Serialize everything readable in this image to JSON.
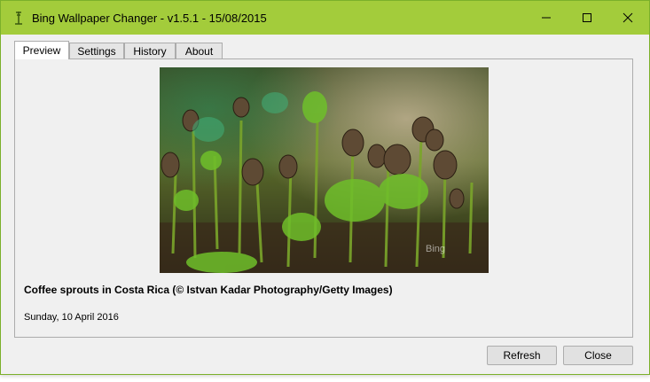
{
  "window": {
    "title": "Bing Wallpaper Changer - v1.5.1 - 15/08/2015",
    "accent_color": "#a3cc3b"
  },
  "tabs": [
    {
      "label": "Preview",
      "active": true
    },
    {
      "label": "Settings",
      "active": false
    },
    {
      "label": "History",
      "active": false
    },
    {
      "label": "About",
      "active": false
    }
  ],
  "preview": {
    "watermark": "Bing",
    "caption": "Coffee sprouts in Costa Rica (© Istvan Kadar Photography/Getty Images)",
    "date": "Sunday, 10 April 2016"
  },
  "buttons": {
    "refresh": "Refresh",
    "close": "Close"
  }
}
